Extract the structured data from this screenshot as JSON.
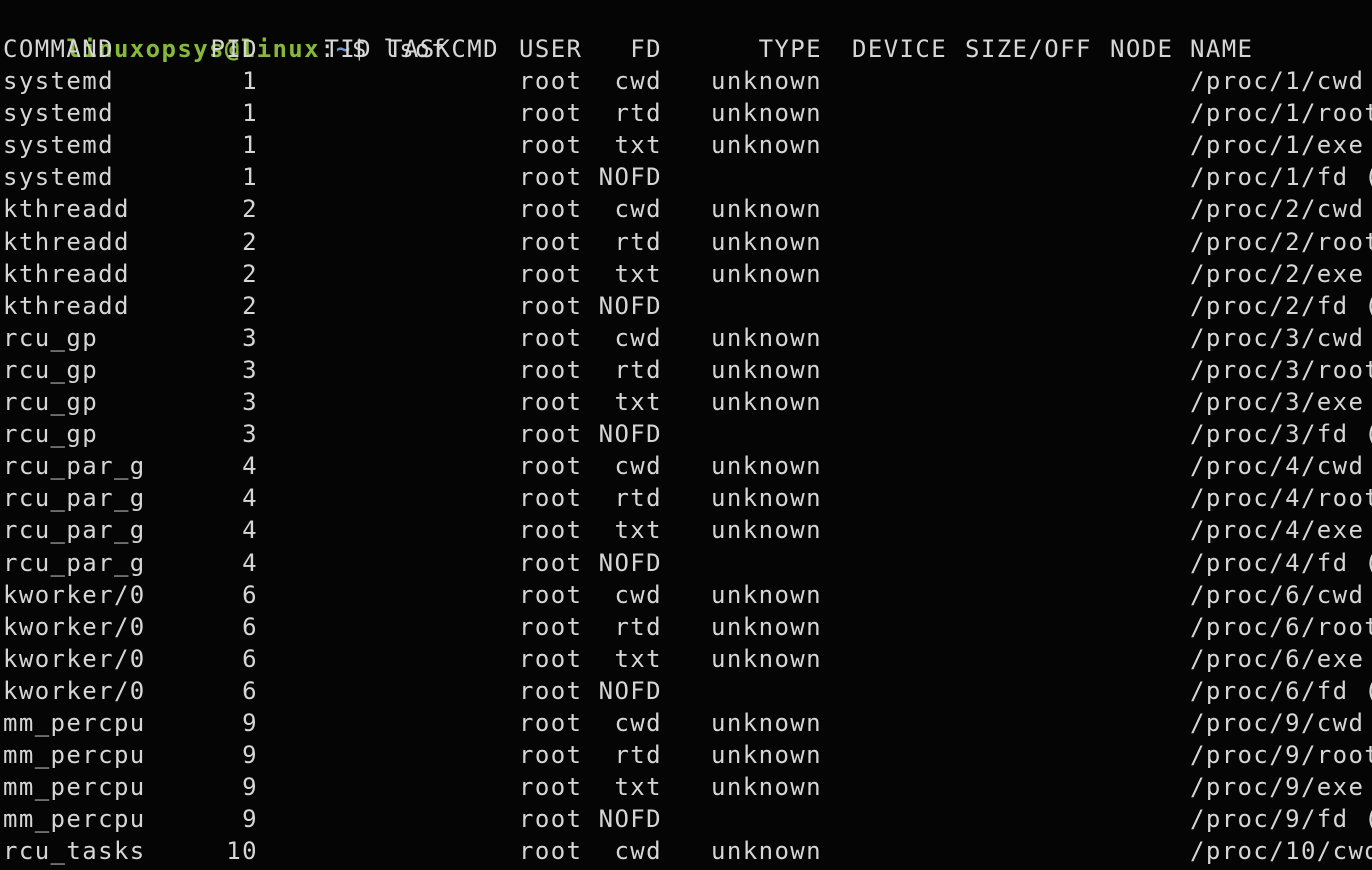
{
  "terminal": {
    "prompt": {
      "user_host": "linuxopsys@linux",
      "separator": ":",
      "path": "~",
      "symbol": "$ ",
      "command": "lsof"
    },
    "colors": {
      "background": "#050505",
      "text": "#d6d6d6",
      "prompt_user": "#86b83a",
      "prompt_path": "#6f94c8"
    },
    "headers": [
      "COMMAND",
      "PID",
      "TID",
      "TASKCMD",
      "USER",
      "FD",
      "TYPE",
      "DEVICE",
      "SIZE/OFF",
      "NODE",
      "NAME"
    ],
    "rows": [
      [
        "systemd",
        "1",
        "",
        "",
        "root",
        "cwd",
        "unknown",
        "",
        "",
        "",
        "/proc/1/cwd"
      ],
      [
        "systemd",
        "1",
        "",
        "",
        "root",
        "rtd",
        "unknown",
        "",
        "",
        "",
        "/proc/1/root"
      ],
      [
        "systemd",
        "1",
        "",
        "",
        "root",
        "txt",
        "unknown",
        "",
        "",
        "",
        "/proc/1/exe"
      ],
      [
        "systemd",
        "1",
        "",
        "",
        "root",
        "NOFD",
        "",
        "",
        "",
        "",
        "/proc/1/fd ("
      ],
      [
        "kthreadd",
        "2",
        "",
        "",
        "root",
        "cwd",
        "unknown",
        "",
        "",
        "",
        "/proc/2/cwd"
      ],
      [
        "kthreadd",
        "2",
        "",
        "",
        "root",
        "rtd",
        "unknown",
        "",
        "",
        "",
        "/proc/2/root"
      ],
      [
        "kthreadd",
        "2",
        "",
        "",
        "root",
        "txt",
        "unknown",
        "",
        "",
        "",
        "/proc/2/exe"
      ],
      [
        "kthreadd",
        "2",
        "",
        "",
        "root",
        "NOFD",
        "",
        "",
        "",
        "",
        "/proc/2/fd ("
      ],
      [
        "rcu_gp",
        "3",
        "",
        "",
        "root",
        "cwd",
        "unknown",
        "",
        "",
        "",
        "/proc/3/cwd"
      ],
      [
        "rcu_gp",
        "3",
        "",
        "",
        "root",
        "rtd",
        "unknown",
        "",
        "",
        "",
        "/proc/3/root"
      ],
      [
        "rcu_gp",
        "3",
        "",
        "",
        "root",
        "txt",
        "unknown",
        "",
        "",
        "",
        "/proc/3/exe"
      ],
      [
        "rcu_gp",
        "3",
        "",
        "",
        "root",
        "NOFD",
        "",
        "",
        "",
        "",
        "/proc/3/fd ("
      ],
      [
        "rcu_par_g",
        "4",
        "",
        "",
        "root",
        "cwd",
        "unknown",
        "",
        "",
        "",
        "/proc/4/cwd"
      ],
      [
        "rcu_par_g",
        "4",
        "",
        "",
        "root",
        "rtd",
        "unknown",
        "",
        "",
        "",
        "/proc/4/root"
      ],
      [
        "rcu_par_g",
        "4",
        "",
        "",
        "root",
        "txt",
        "unknown",
        "",
        "",
        "",
        "/proc/4/exe"
      ],
      [
        "rcu_par_g",
        "4",
        "",
        "",
        "root",
        "NOFD",
        "",
        "",
        "",
        "",
        "/proc/4/fd ("
      ],
      [
        "kworker/0",
        "6",
        "",
        "",
        "root",
        "cwd",
        "unknown",
        "",
        "",
        "",
        "/proc/6/cwd"
      ],
      [
        "kworker/0",
        "6",
        "",
        "",
        "root",
        "rtd",
        "unknown",
        "",
        "",
        "",
        "/proc/6/root"
      ],
      [
        "kworker/0",
        "6",
        "",
        "",
        "root",
        "txt",
        "unknown",
        "",
        "",
        "",
        "/proc/6/exe"
      ],
      [
        "kworker/0",
        "6",
        "",
        "",
        "root",
        "NOFD",
        "",
        "",
        "",
        "",
        "/proc/6/fd ("
      ],
      [
        "mm_percpu",
        "9",
        "",
        "",
        "root",
        "cwd",
        "unknown",
        "",
        "",
        "",
        "/proc/9/cwd"
      ],
      [
        "mm_percpu",
        "9",
        "",
        "",
        "root",
        "rtd",
        "unknown",
        "",
        "",
        "",
        "/proc/9/root"
      ],
      [
        "mm_percpu",
        "9",
        "",
        "",
        "root",
        "txt",
        "unknown",
        "",
        "",
        "",
        "/proc/9/exe"
      ],
      [
        "mm_percpu",
        "9",
        "",
        "",
        "root",
        "NOFD",
        "",
        "",
        "",
        "",
        "/proc/9/fd ("
      ],
      [
        "rcu_tasks",
        "10",
        "",
        "",
        "root",
        "cwd",
        "unknown",
        "",
        "",
        "",
        "/proc/10/cwd"
      ]
    ]
  }
}
